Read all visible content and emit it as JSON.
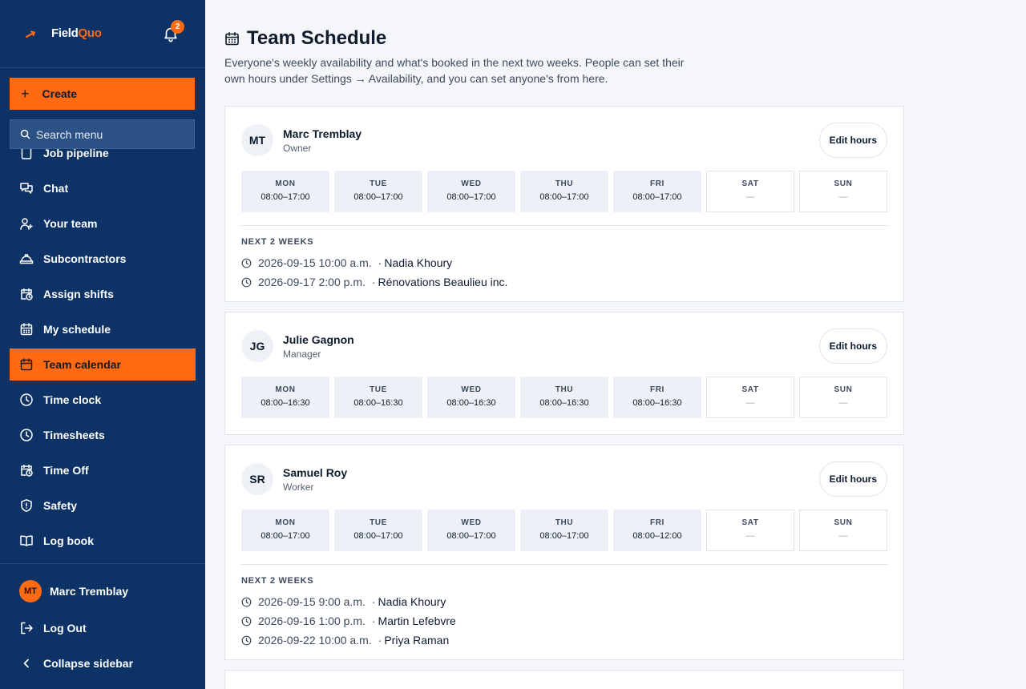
{
  "brand": {
    "name_part1": "Field",
    "name_part2": "Quo",
    "notification_count": "2"
  },
  "sidebar": {
    "create_label": "Create",
    "search_placeholder": "Search menu",
    "items": [
      {
        "label": "Job pipeline",
        "icon": "clipboard-icon"
      },
      {
        "label": "Chat",
        "icon": "chat-icon"
      },
      {
        "label": "Your team",
        "icon": "users-icon"
      },
      {
        "label": "Subcontractors",
        "icon": "hardhat-icon"
      },
      {
        "label": "Assign shifts",
        "icon": "calendar-clock-icon"
      },
      {
        "label": "My schedule",
        "icon": "calendar-grid-icon"
      },
      {
        "label": "Team calendar",
        "icon": "calendar-icon",
        "active": true
      },
      {
        "label": "Time clock",
        "icon": "clock-icon"
      },
      {
        "label": "Timesheets",
        "icon": "clock-icon"
      },
      {
        "label": "Time Off",
        "icon": "calendar-clock-icon"
      },
      {
        "label": "Safety",
        "icon": "shield-icon"
      },
      {
        "label": "Log book",
        "icon": "book-icon"
      }
    ],
    "user": {
      "initials": "MT",
      "name": "Marc Tremblay"
    },
    "logout_label": "Log Out",
    "collapse_label": "Collapse sidebar"
  },
  "colors": {
    "sidebar_bg": "#0d3366",
    "accent": "#ff6a13",
    "page_bg": "#f4f6fa"
  },
  "page": {
    "title": "Team Schedule",
    "description": "Everyone's weekly availability and what's booked in the next two weeks. People can set their own hours under Settings → Availability, and you can set anyone's from here."
  },
  "edit_hours_label": "Edit hours",
  "next_label": "NEXT 2 WEEKS",
  "people": [
    {
      "initials": "MT",
      "name": "Marc Tremblay",
      "role": "Owner",
      "days": [
        {
          "day": "MON",
          "hours": "08:00–17:00"
        },
        {
          "day": "TUE",
          "hours": "08:00–17:00"
        },
        {
          "day": "WED",
          "hours": "08:00–17:00"
        },
        {
          "day": "THU",
          "hours": "08:00–17:00"
        },
        {
          "day": "FRI",
          "hours": "08:00–17:00"
        },
        {
          "day": "SAT",
          "hours": "—",
          "off": true
        },
        {
          "day": "SUN",
          "hours": "—",
          "off": true
        }
      ],
      "bookings": [
        {
          "when": "2026-09-15 10:00 a.m.",
          "who": "Nadia Khoury"
        },
        {
          "when": "2026-09-17 2:00 p.m.",
          "who": "Rénovations Beaulieu inc."
        }
      ]
    },
    {
      "initials": "JG",
      "name": "Julie Gagnon",
      "role": "Manager",
      "days": [
        {
          "day": "MON",
          "hours": "08:00–16:30"
        },
        {
          "day": "TUE",
          "hours": "08:00–16:30"
        },
        {
          "day": "WED",
          "hours": "08:00–16:30"
        },
        {
          "day": "THU",
          "hours": "08:00–16:30"
        },
        {
          "day": "FRI",
          "hours": "08:00–16:30"
        },
        {
          "day": "SAT",
          "hours": "—",
          "off": true
        },
        {
          "day": "SUN",
          "hours": "—",
          "off": true
        }
      ],
      "bookings": []
    },
    {
      "initials": "SR",
      "name": "Samuel Roy",
      "role": "Worker",
      "days": [
        {
          "day": "MON",
          "hours": "08:00–17:00"
        },
        {
          "day": "TUE",
          "hours": "08:00–17:00"
        },
        {
          "day": "WED",
          "hours": "08:00–17:00"
        },
        {
          "day": "THU",
          "hours": "08:00–17:00"
        },
        {
          "day": "FRI",
          "hours": "08:00–12:00"
        },
        {
          "day": "SAT",
          "hours": "—",
          "off": true
        },
        {
          "day": "SUN",
          "hours": "—",
          "off": true
        }
      ],
      "bookings": [
        {
          "when": "2026-09-15 9:00 a.m.",
          "who": "Nadia Khoury"
        },
        {
          "when": "2026-09-16 1:00 p.m.",
          "who": "Martin Lefebvre"
        },
        {
          "when": "2026-09-22 10:00 a.m.",
          "who": "Priya Raman"
        }
      ]
    }
  ]
}
